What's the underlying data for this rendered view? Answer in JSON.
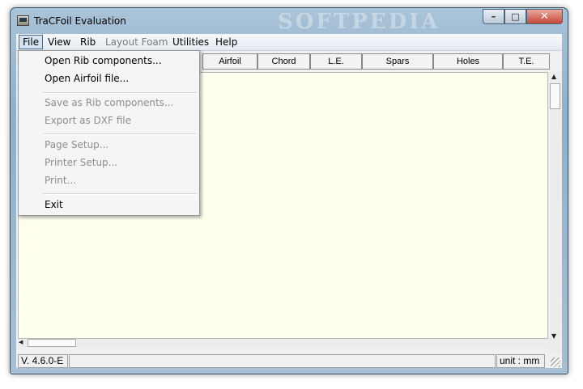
{
  "window": {
    "title": "TraCFoil Evaluation",
    "watermark": "SOFTPEDIA"
  },
  "window_controls": {
    "minimize": "–",
    "maximize": "□",
    "close": "✕"
  },
  "menubar": {
    "items": [
      {
        "label": "File",
        "state": "active"
      },
      {
        "label": "View",
        "state": "enabled"
      },
      {
        "label": "Rib",
        "state": "enabled"
      },
      {
        "label": "Layout Foam",
        "state": "disabled"
      },
      {
        "label": "Utilities",
        "state": "enabled"
      },
      {
        "label": "Help",
        "state": "enabled"
      }
    ]
  },
  "tabs": [
    "Airfoil",
    "Chord",
    "L.E.",
    "Spars",
    "Holes",
    "T.E."
  ],
  "file_menu": {
    "items": [
      {
        "label": "Open Rib components...",
        "enabled": true
      },
      {
        "label": "Open Airfoil file...",
        "enabled": true
      },
      {
        "label": "Save as Rib components...",
        "enabled": false
      },
      {
        "label": "Export as DXF file",
        "enabled": false
      },
      {
        "label": "Page Setup...",
        "enabled": false
      },
      {
        "label": "Printer Setup...",
        "enabled": false
      },
      {
        "label": "Print...",
        "enabled": false
      },
      {
        "label": "Exit",
        "enabled": true
      }
    ]
  },
  "statusbar": {
    "version": "V. 4.6.0-E",
    "middle": "",
    "unit": "unit : mm"
  },
  "colors": {
    "canvas": "#fffff0",
    "titlebar": "#a9c3d8",
    "close_button": "#c7463a"
  }
}
